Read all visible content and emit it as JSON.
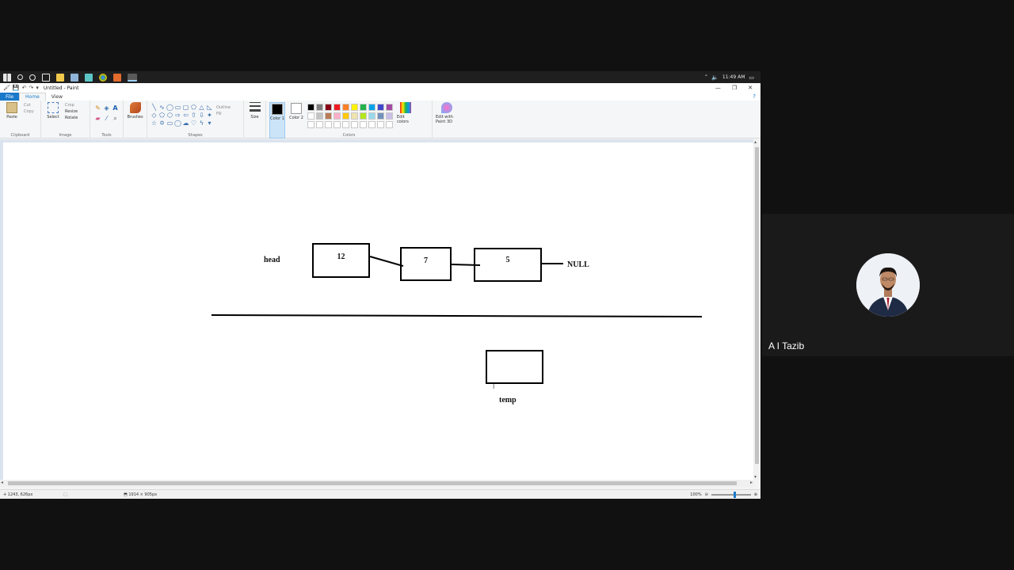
{
  "app": {
    "window_title": "Untitled - Paint"
  },
  "taskbar": {
    "time": "11:49 AM"
  },
  "tabs": {
    "file": "File",
    "home": "Home",
    "view": "View"
  },
  "ribbon": {
    "clipboard": {
      "label": "Clipboard",
      "paste": "Paste",
      "cut": "Cut",
      "copy": "Copy"
    },
    "image": {
      "label": "Image",
      "select": "Select",
      "crop": "Crop",
      "resize": "Resize",
      "rotate": "Rotate"
    },
    "tools": {
      "label": "Tools"
    },
    "brushes": {
      "label": "Brushes"
    },
    "shapes": {
      "label": "Shapes",
      "outline": "Outline",
      "fill": "Fill"
    },
    "size": {
      "label": "Size"
    },
    "colors": {
      "label": "Colors",
      "color1": "Color 1",
      "color2": "Color 2",
      "edit_colors": "Edit colors",
      "edit_3d": "Edit with Paint 3D"
    },
    "palette_row1": [
      "#000000",
      "#7f7f7f",
      "#880015",
      "#ed1c24",
      "#ff7f27",
      "#fff200",
      "#22b14c",
      "#00a2e8",
      "#3f48cc",
      "#a349a4"
    ],
    "palette_row2": [
      "#ffffff",
      "#c3c3c3",
      "#b97a57",
      "#ffaec9",
      "#ffc90e",
      "#efe4b0",
      "#b5e61d",
      "#99d9ea",
      "#7092be",
      "#c8bfe7"
    ]
  },
  "drawing": {
    "head_label": "head",
    "nodes": [
      "12",
      "7",
      "5"
    ],
    "null_label": "NULL",
    "temp_label": "temp"
  },
  "statusbar": {
    "cursor_pos": "1243, 626px",
    "image_size": "1914 × 905px",
    "zoom": "100%"
  },
  "participant": {
    "name": "A I Tazib"
  }
}
